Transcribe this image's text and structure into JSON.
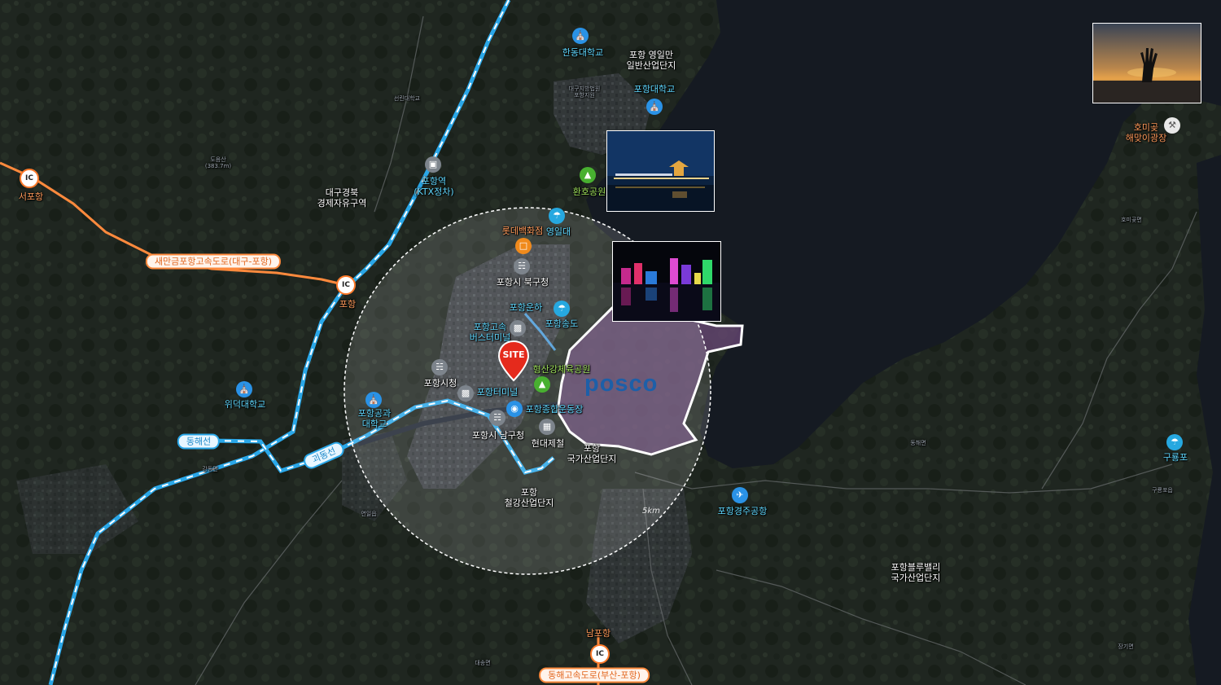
{
  "map_labels": {
    "handong": "한동대학교",
    "yeongil": "포항 영일만\n일반산업단지",
    "pohang_univ": "포항대학교",
    "hwanho": "환호공원",
    "homigot": "호미곶\n해맞이광장",
    "seopohang": "서포항",
    "ktx": "포항역\n(KTX정차)",
    "daegu_free_zone": "대구경북\n경제자유구역",
    "lotte": "롯데백화점",
    "yeongildae": "영일대",
    "buk_gu": "포항시 북구청",
    "canal": "포항운하",
    "songdo": "포항송도",
    "express_bus": "포항고속\n버스터미널",
    "hyeongsan": "형산강체육공원",
    "city_hall": "포항시청",
    "terminal": "포항터미널",
    "stadium": "포항종합운동장",
    "nam_gu": "포항시 남구청",
    "hyundai_steel": "현대제철",
    "national_complex": "포항\n국가산업단지",
    "steel_complex": "포항\n철강산업단지",
    "pohang_ic": "포항",
    "wideok": "위덕대학교",
    "polytech": "포항공과\n대학교",
    "airport": "포항경주공항",
    "bluevalley": "포항블루밸리\n국가산업단지",
    "guryongpo": "구룡포",
    "nampohang": "남포항",
    "posco": "posco",
    "site": "SITE",
    "radius": "5km",
    "ic": "IC"
  },
  "road_labels": {
    "saemangeum": "새만금포항고속도로(대구-포항)",
    "donghae_expressway": "동해고속도로(부산-포항)",
    "donghae_line": "동해선",
    "goedong_line": "괴동선"
  },
  "base_text": {
    "t1": "대구지방법원\n포항지원",
    "t2": "선린대학교",
    "t3": "도음산\n(383.7m)",
    "t4": "호미곶면",
    "t5": "동해면",
    "t6": "연일읍",
    "t7": "강동면",
    "t8": "대송면",
    "t9": "장기면",
    "t10": "구룡포읍"
  },
  "colors": {
    "expressway": "#ff8a3d",
    "railway": "#2aa7e8",
    "industrial_fill": "#6b4a78",
    "site_pin": "#e52a1c",
    "posco_logo": "#1d5fa8"
  },
  "icons": {
    "ic_marker": "ic-circle-icon",
    "university": "university-icon",
    "government": "government-building-icon",
    "park": "tree-icon",
    "department_store": "shopping-bag-icon",
    "bus": "bus-icon",
    "beach": "beach-umbrella-icon",
    "airport": "airplane-icon",
    "restaurant": "fork-knife-icon",
    "site": "location-pin-icon"
  }
}
